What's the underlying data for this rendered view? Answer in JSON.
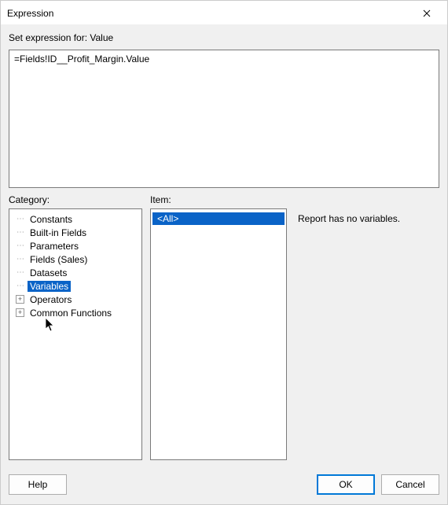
{
  "window": {
    "title": "Expression"
  },
  "labels": {
    "set_for": "Set expression for: Value",
    "category": "Category:",
    "item": "Item:"
  },
  "expression": {
    "value": "=Fields!ID__Profit_Margin.Value"
  },
  "category_tree": [
    {
      "label": "Constants",
      "expandable": false,
      "expanded": false,
      "selected": false
    },
    {
      "label": "Built-in Fields",
      "expandable": false,
      "expanded": false,
      "selected": false
    },
    {
      "label": "Parameters",
      "expandable": false,
      "expanded": false,
      "selected": false
    },
    {
      "label": "Fields (Sales)",
      "expandable": false,
      "expanded": false,
      "selected": false
    },
    {
      "label": "Datasets",
      "expandable": false,
      "expanded": false,
      "selected": false
    },
    {
      "label": "Variables",
      "expandable": false,
      "expanded": false,
      "selected": true
    },
    {
      "label": "Operators",
      "expandable": true,
      "expanded": false,
      "selected": false
    },
    {
      "label": "Common Functions",
      "expandable": true,
      "expanded": false,
      "selected": false
    }
  ],
  "items": [
    {
      "label": "<All>",
      "selected": true
    }
  ],
  "description": "Report has no variables.",
  "buttons": {
    "help": "Help",
    "ok": "OK",
    "cancel": "Cancel"
  }
}
